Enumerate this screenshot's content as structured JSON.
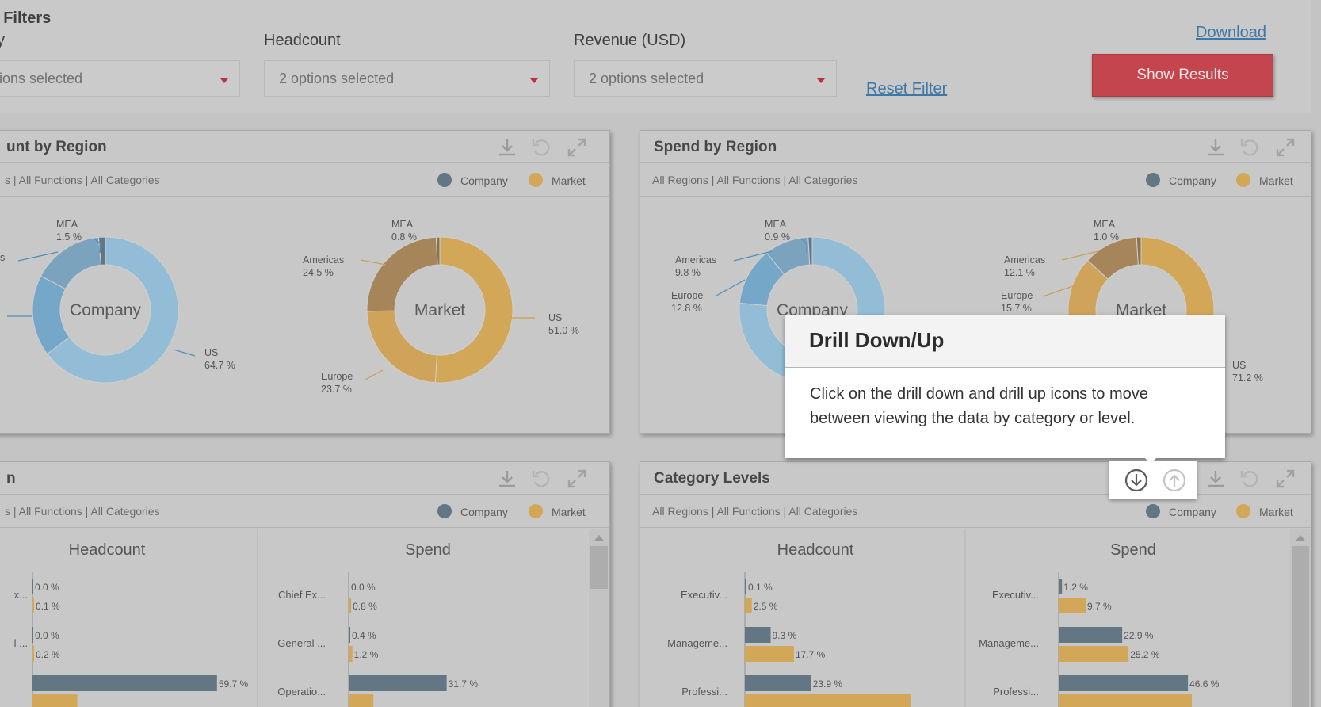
{
  "filters": {
    "title": "t Filters",
    "category_label": "y",
    "category_value": "ions selected",
    "headcount_label": "Headcount",
    "headcount_value": "2 options selected",
    "revenue_label": "Revenue (USD)",
    "revenue_value": "2 options selected",
    "reset_label": "Reset Filter",
    "download_label": "Download",
    "show_results_label": "Show Results"
  },
  "legend": {
    "company": "Company",
    "market": "Market"
  },
  "colors": {
    "company": "#627683",
    "market": "#d2a858",
    "background": "#c4c4c4",
    "accent": "#c4454d",
    "link": "#3d78a6"
  },
  "panels": {
    "headcount_region": {
      "title": "unt by Region",
      "subtitle": "s | All Functions | All Categories",
      "company_center": "Company",
      "market_center": "Market",
      "company_slices": [
        {
          "region": "US",
          "value": "64.7 %"
        },
        {
          "region": "Europe",
          "value": ""
        },
        {
          "region": "as",
          "value": ""
        },
        {
          "region": "MEA",
          "value": "1.5 %"
        }
      ],
      "market_slices": [
        {
          "region": "US",
          "value": "51.0 %"
        },
        {
          "region": "Europe",
          "value": "23.7 %"
        },
        {
          "region": "Americas",
          "value": "24.5 %"
        },
        {
          "region": "MEA",
          "value": "0.8 %"
        }
      ]
    },
    "spend_region": {
      "title": "Spend by Region",
      "subtitle": "All Regions | All Functions | All Categories",
      "company_center": "Company",
      "market_center": "Market",
      "company_slices": [
        {
          "region": "US",
          "value": ""
        },
        {
          "region": "Europe",
          "value": "12.8 %"
        },
        {
          "region": "Americas",
          "value": "9.8 %"
        },
        {
          "region": "MEA",
          "value": "0.9 %"
        }
      ],
      "market_slices": [
        {
          "region": "US",
          "value": "71.2 %"
        },
        {
          "region": "Europe",
          "value": "15.7 %"
        },
        {
          "region": "Americas",
          "value": "12.1 %"
        },
        {
          "region": "MEA",
          "value": "1.0 %"
        }
      ]
    },
    "function_panel": {
      "title": "n",
      "subtitle": "s | All Functions | All Categories",
      "headcount_title": "Headcount",
      "spend_title": "Spend",
      "headcount_rows": [
        {
          "label": "x...",
          "company": "0.0 %",
          "market": "0.1 %"
        },
        {
          "label": "l ...",
          "company": "0.0 %",
          "market": "0.2 %"
        },
        {
          "label": "",
          "company": "59.7 %",
          "market": ""
        }
      ],
      "spend_rows": [
        {
          "label": "Chief Ex...",
          "company": "0.0 %",
          "market": "0.8 %"
        },
        {
          "label": "General ...",
          "company": "0.4 %",
          "market": "1.2 %"
        },
        {
          "label": "Operatio...",
          "company": "31.7 %",
          "market": ""
        }
      ]
    },
    "category_levels": {
      "title": "Category Levels",
      "subtitle": "All Regions | All Functions | All Categories",
      "headcount_title": "Headcount",
      "spend_title": "Spend",
      "headcount_rows": [
        {
          "label": "Executiv...",
          "company": "0.1 %",
          "market": "2.5 %"
        },
        {
          "label": "Manageme...",
          "company": "9.3 %",
          "market": "17.7 %"
        },
        {
          "label": "Professi...",
          "company": "23.9 %",
          "market": ""
        }
      ],
      "spend_rows": [
        {
          "label": "Executiv...",
          "company": "1.2 %",
          "market": "9.7 %"
        },
        {
          "label": "Manageme...",
          "company": "22.9 %",
          "market": "25.2 %"
        },
        {
          "label": "Professi...",
          "company": "46.6 %",
          "market": ""
        }
      ]
    }
  },
  "tooltip": {
    "title": "Drill Down/Up",
    "body": "Click on the drill down and drill up icons to move between viewing the data by category or level."
  },
  "chart_data": [
    {
      "type": "pie",
      "title": "Company",
      "categories": [
        "US",
        "Europe",
        "Americas",
        "MEA"
      ],
      "values": [
        64.7,
        18.0,
        15.8,
        1.5
      ]
    },
    {
      "type": "pie",
      "title": "Market",
      "categories": [
        "US",
        "Europe",
        "Americas",
        "MEA"
      ],
      "values": [
        51.0,
        23.7,
        24.5,
        0.8
      ]
    },
    {
      "type": "pie",
      "title": "Company",
      "categories": [
        "US",
        "Europe",
        "Americas",
        "MEA"
      ],
      "values": [
        76.5,
        12.8,
        9.8,
        0.9
      ]
    },
    {
      "type": "pie",
      "title": "Market",
      "categories": [
        "US",
        "Europe",
        "Americas",
        "MEA"
      ],
      "values": [
        71.2,
        15.7,
        12.1,
        1.0
      ]
    },
    {
      "type": "bar",
      "title": "Headcount",
      "categories": [
        "x...",
        "l ...",
        ""
      ],
      "series": [
        {
          "name": "Company",
          "values": [
            0.0,
            0.0,
            59.7
          ]
        },
        {
          "name": "Market",
          "values": [
            0.1,
            0.2,
            14.5
          ]
        }
      ]
    },
    {
      "type": "bar",
      "title": "Spend",
      "categories": [
        "Chief Ex...",
        "General ...",
        "Operatio..."
      ],
      "series": [
        {
          "name": "Company",
          "values": [
            0.0,
            0.4,
            31.7
          ]
        },
        {
          "name": "Market",
          "values": [
            0.8,
            1.2,
            8.0
          ]
        }
      ]
    },
    {
      "type": "bar",
      "title": "Headcount",
      "categories": [
        "Executiv...",
        "Manageme...",
        "Professi..."
      ],
      "series": [
        {
          "name": "Company",
          "values": [
            0.1,
            9.3,
            23.9
          ]
        },
        {
          "name": "Market",
          "values": [
            2.5,
            17.7,
            60.0
          ]
        }
      ]
    },
    {
      "type": "bar",
      "title": "Spend",
      "categories": [
        "Executiv...",
        "Manageme...",
        "Professi..."
      ],
      "series": [
        {
          "name": "Company",
          "values": [
            1.2,
            22.9,
            46.6
          ]
        },
        {
          "name": "Market",
          "values": [
            9.7,
            25.2,
            48.0
          ]
        }
      ]
    }
  ]
}
